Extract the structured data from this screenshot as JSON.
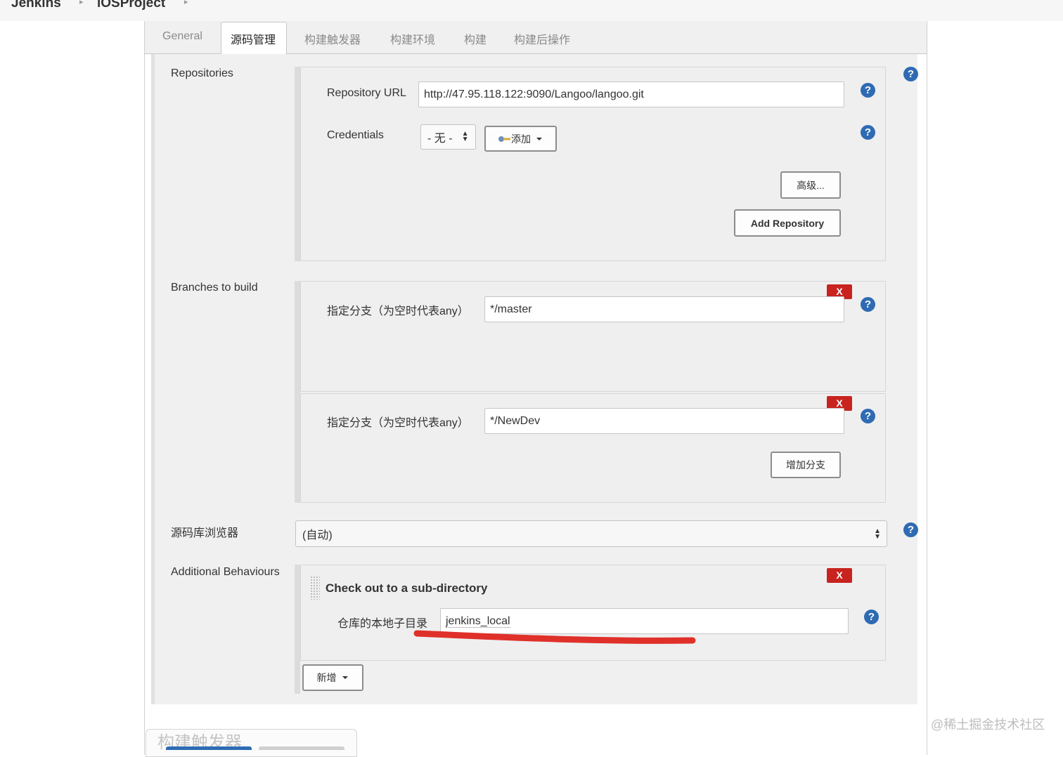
{
  "breadcrumb": {
    "home": "Jenkins",
    "project": "iOSProject"
  },
  "tabs": [
    "General",
    "源码管理",
    "构建触发器",
    "构建环境",
    "构建",
    "构建后操作"
  ],
  "active_tab": "源码管理",
  "repositories": {
    "section_label": "Repositories",
    "url_label": "Repository URL",
    "url_value": "http://47.95.118.122:9090/Langoo/langoo.git",
    "credentials_label": "Credentials",
    "credentials_value": "- 无 -",
    "add_button": "添加",
    "advanced_button": "高级...",
    "add_repository_button": "Add Repository"
  },
  "branches": {
    "section_label": "Branches to build",
    "branch_label": "指定分支（为空时代表any）",
    "items": [
      "*/master",
      "*/NewDev"
    ],
    "delete_label": "X",
    "add_branch_button": "增加分支"
  },
  "browser": {
    "label": "源码库浏览器",
    "value": "(自动)"
  },
  "behaviours": {
    "section_label": "Additional Behaviours",
    "title": "Check out to a sub-directory",
    "subdir_label": "仓库的本地子目录",
    "subdir_value": "jenkins_local",
    "delete_label": "X",
    "add_button": "新增"
  },
  "next_section_title": "构建触发器",
  "help_glyph": "?",
  "watermark": "@稀土掘金技术社区",
  "colors": {
    "delete": "#c8231e",
    "help": "#2e6bb3",
    "annotation": "#e0302a"
  }
}
